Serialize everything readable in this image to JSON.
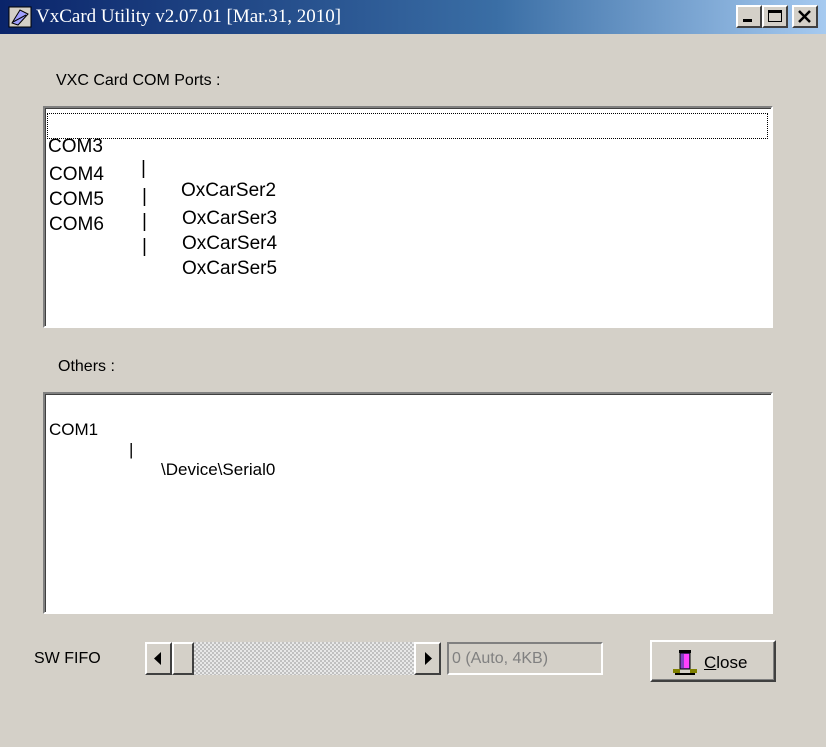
{
  "window": {
    "title": "VxCard Utility v2.07.01 [Mar.31, 2010]",
    "title_buttons": [
      "minimize-icon",
      "maximize-icon",
      "close-icon"
    ]
  },
  "vxc_section": {
    "label": "VXC Card COM Ports :",
    "items": [
      {
        "port": "COM3",
        "sep": "|",
        "name": "OxCarSer2"
      },
      {
        "port": "COM4",
        "sep": "|",
        "name": "OxCarSer3"
      },
      {
        "port": "COM5",
        "sep": "|",
        "name": "OxCarSer4"
      },
      {
        "port": "COM6",
        "sep": "|",
        "name": "OxCarSer5"
      }
    ]
  },
  "others_section": {
    "label": "Others :",
    "items": [
      {
        "port": "COM1",
        "sep": "|",
        "name": "\\Device\\Serial0"
      }
    ]
  },
  "fifo": {
    "label": "SW FIFO",
    "value_text": "0 (Auto, 4KB)"
  },
  "close_button": {
    "accel": "C",
    "rest": "lose",
    "icon": "door-exit-icon"
  },
  "colors": {
    "face": "#d4d0c8",
    "title_start": "#0a246a",
    "title_end": "#a6caf0"
  }
}
